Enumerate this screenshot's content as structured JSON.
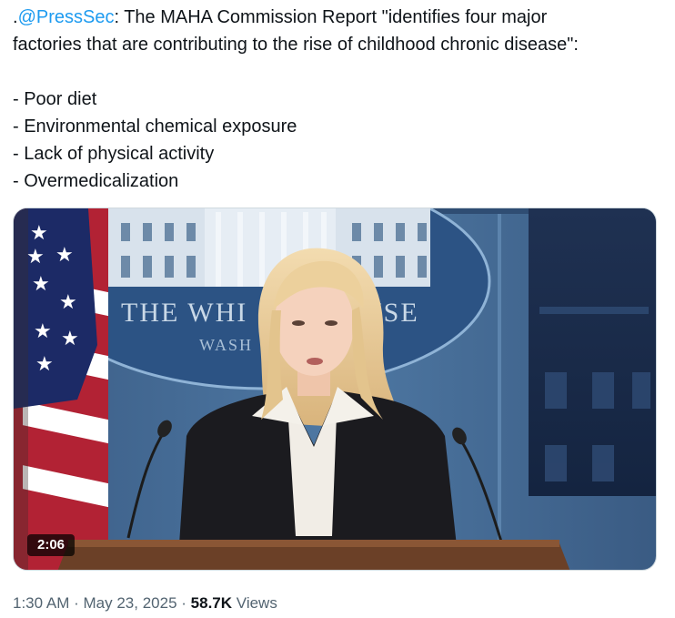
{
  "tweet": {
    "mention": "@PressSec",
    "prefix": ".",
    "line1_rest": ": The MAHA Commission Report \"identifies four major",
    "line2": "factories that are contributing to the rise of childhood chronic disease\":",
    "bullets": [
      "- Poor diet",
      "- Environmental chemical exposure",
      "- Lack of physical activity",
      "- Overmedicalization"
    ]
  },
  "media": {
    "type": "video",
    "duration": "2:06",
    "backdrop_text_line1": "THE WHI",
    "backdrop_text_line1b": "USE",
    "backdrop_text_line2": "WASH"
  },
  "meta": {
    "time": "1:30 AM",
    "separator": "·",
    "date": "May 23, 2025",
    "views_count": "58.7K",
    "views_label": "Views"
  },
  "colors": {
    "link": "#1d9bf0",
    "text": "#0f1419",
    "secondary": "#536471"
  }
}
